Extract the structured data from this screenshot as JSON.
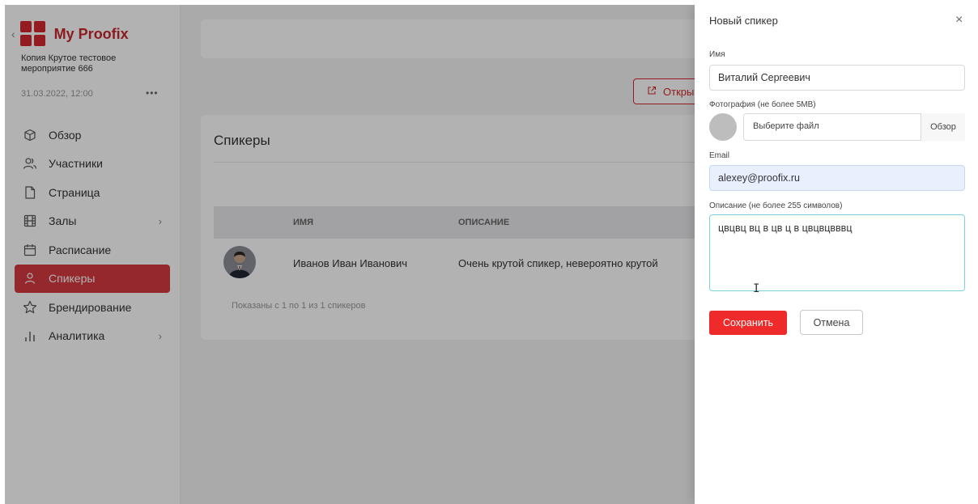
{
  "sidebar": {
    "back_glyph": "‹",
    "brand_name": "My Proofix",
    "event_name": "Копия Крутое тестовое мероприятие 666",
    "event_date": "31.03.2022, 12:00",
    "more_glyph": "•••",
    "items": [
      {
        "label": "Обзор",
        "icon": "box-icon",
        "active": false
      },
      {
        "label": "Участники",
        "icon": "users-icon",
        "active": false
      },
      {
        "label": "Страница",
        "icon": "page-icon",
        "active": false
      },
      {
        "label": "Залы",
        "icon": "film-icon",
        "active": false,
        "has_chevron": true
      },
      {
        "label": "Расписание",
        "icon": "calendar-icon",
        "active": false
      },
      {
        "label": "Спикеры",
        "icon": "person-icon",
        "active": true
      },
      {
        "label": "Брендирование",
        "icon": "star-icon",
        "active": false
      },
      {
        "label": "Аналитика",
        "icon": "bar-chart-icon",
        "active": false,
        "has_chevron": true
      }
    ],
    "chevron_glyph": "›"
  },
  "main": {
    "open_button_label": "Откры",
    "card_title": "Спикеры",
    "table": {
      "headers": [
        "ИМЯ",
        "ОПИСАНИЕ"
      ],
      "rows": [
        {
          "name": "Иванов Иван Иванович",
          "description": "Очень крутой спикер, невероятно крутой"
        }
      ]
    },
    "shown_text": "Показаны с 1 по 1 из 1 спикеров"
  },
  "drawer": {
    "title": "Новый спикер",
    "close_glyph": "×",
    "name_label": "Имя",
    "name_value": "Виталий Сергеевич",
    "photo_label": "Фотография (не более 5MB)",
    "file_placeholder": "Выберите файл",
    "file_button": "Обзор",
    "email_label": "Email",
    "email_value": "alexey@proofix.ru",
    "description_label": "Описание (не более 255 символов)",
    "description_value": "цвцвц вц в цв ц в цвцвцвввц",
    "text_cursor_glyph": "I",
    "save_label": "Сохранить",
    "cancel_label": "Отмена"
  },
  "colors": {
    "brand": "#d4292f",
    "active_nav": "#d43a3f",
    "save_button": "#ee2a2a",
    "textarea_focus": "#7ad3df",
    "email_autofill": "#e8f0fe"
  }
}
